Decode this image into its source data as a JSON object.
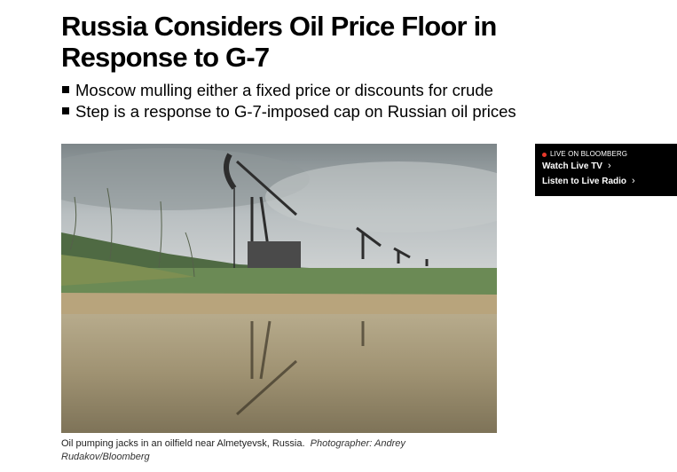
{
  "article": {
    "headline": "Russia Considers Oil Price Floor in Response to G-7",
    "bullets": [
      "Moscow mulling either a fixed price or discounts for crude",
      "Step is a response to G-7-imposed cap on Russian oil prices"
    ],
    "photo": {
      "icon": "oil-field-photo",
      "caption": "Oil pumping jacks in an oilfield near Almetyevsk, Russia.",
      "credit": "Photographer: Andrey Rudakov/Bloomberg"
    }
  },
  "live_widget": {
    "tag": "LIVE ON BLOOMBERG",
    "links": [
      {
        "label": "Watch Live TV",
        "icon": "chevron-right-icon"
      },
      {
        "label": "Listen to Live Radio",
        "icon": "chevron-right-icon"
      }
    ],
    "accent_color": "#e8392b"
  }
}
